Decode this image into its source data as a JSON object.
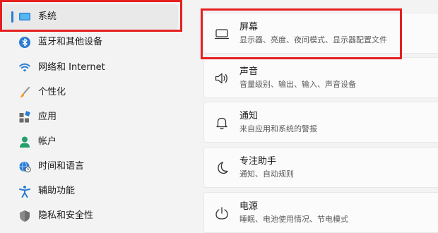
{
  "sidebar": {
    "items": [
      {
        "label": "系统",
        "icon": "monitor-icon"
      },
      {
        "label": "蓝牙和其他设备",
        "icon": "bluetooth-icon"
      },
      {
        "label": "网络和 Internet",
        "icon": "wifi-icon"
      },
      {
        "label": "个性化",
        "icon": "brush-icon"
      },
      {
        "label": "应用",
        "icon": "apps-icon"
      },
      {
        "label": "帐户",
        "icon": "account-icon"
      },
      {
        "label": "时间和语言",
        "icon": "globe-clock-icon"
      },
      {
        "label": "辅助功能",
        "icon": "accessibility-icon"
      },
      {
        "label": "隐私和安全性",
        "icon": "shield-icon"
      }
    ]
  },
  "cards": [
    {
      "title": "屏幕",
      "subtitle": "显示器、亮度、夜间模式、显示器配置文件",
      "icon": "display-icon"
    },
    {
      "title": "声音",
      "subtitle": "音量级别、输出、输入、声音设备",
      "icon": "speaker-icon"
    },
    {
      "title": "通知",
      "subtitle": "来自应用和系统的警报",
      "icon": "bell-icon"
    },
    {
      "title": "专注助手",
      "subtitle": "通知、自动规则",
      "icon": "moon-icon"
    },
    {
      "title": "电源",
      "subtitle": "睡眠、电池使用情况、节电模式",
      "icon": "power-icon"
    }
  ],
  "colors": {
    "accent": "#2a7cd3",
    "highlight": "#e61f1f"
  }
}
